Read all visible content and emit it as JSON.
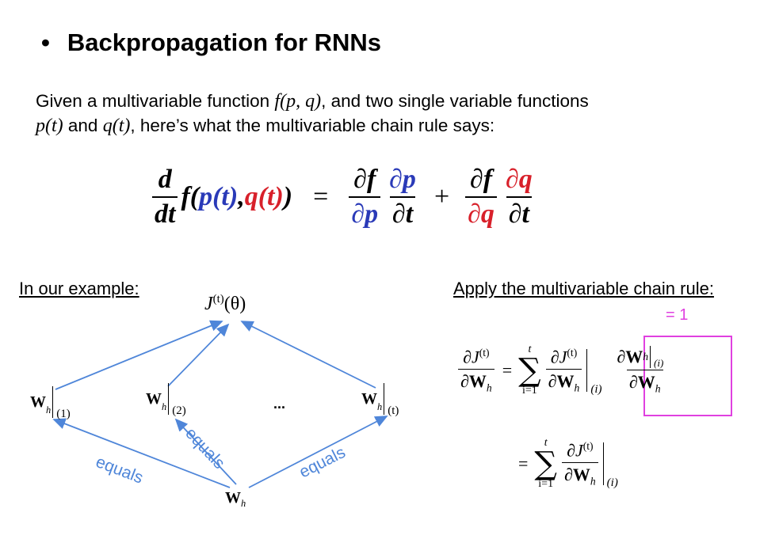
{
  "slide": {
    "heading": {
      "bullet": "•",
      "title": "Backpropagation for RNNs"
    },
    "intro": {
      "line1_a": "Given a multivariable function ",
      "f_expr": "f(p, q)",
      "line1_b": ", and two single variable functions",
      "p_expr": "p(t)",
      "and_word": " and ",
      "q_expr": "q(t)",
      "line2_b": ", here’s what the multivariable chain rule says:"
    },
    "chain_rule": {
      "d": "d",
      "dt": "dt",
      "f_open": "f(",
      "p_of_t": "p(t)",
      "comma": ", ",
      "q_of_t": "q(t)",
      "close": ")",
      "equals": "=",
      "partial_f": "∂f",
      "partial_p": "∂p",
      "partial_t": "∂t",
      "partial_q": "∂q",
      "plus": "+"
    },
    "left_panel": {
      "heading": "In our example:",
      "root_J": "J",
      "root_sup": "(t)",
      "root_arg": "(θ)",
      "nodes": [
        {
          "W": "W",
          "h": "h",
          "idx": "(1)"
        },
        {
          "W": "W",
          "h": "h",
          "idx": "(2)"
        },
        {
          "W": "W",
          "h": "h",
          "idx": "(t)"
        }
      ],
      "ellipsis": "...",
      "bottom_W": "W",
      "bottom_h": "h",
      "edge_labels": [
        "equals",
        "equals",
        "equals"
      ],
      "arrow_color": "#4f86d9"
    },
    "right_panel": {
      "heading": "Apply the multivariable chain rule:",
      "annotation": "= 1",
      "annotation_color": "#e040e0",
      "partial": "∂",
      "J": "J",
      "t_sup": "(t)",
      "W": "W",
      "h": "h",
      "equals": "=",
      "sum_upper": "t",
      "sum_lower": "i=1",
      "sigma": "∑",
      "i_sub": "(i)"
    }
  }
}
